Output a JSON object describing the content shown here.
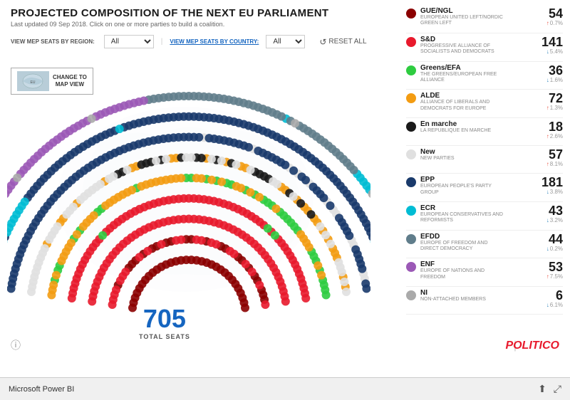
{
  "header": {
    "title": "PROJECTED COMPOSITION OF THE NEXT EU PARLIAMENT",
    "subtitle": "Last updated 09 Sep 2018. Click on one or more parties to build a coalition.",
    "view_region_label": "VIEW MEP SEATS BY REGION:",
    "view_country_label": "VIEW MEP SEATS BY COUNTRY:",
    "region_default": "All",
    "country_default": "All",
    "reset_label": "RESET ALL"
  },
  "map_button": {
    "text": "CHANGE TO\nMAP VIEW"
  },
  "chart": {
    "total_seats": "705",
    "total_seats_label": "TOTAL SEATS"
  },
  "parties": [
    {
      "id": "GUE_NGL",
      "name": "GUE/NGL",
      "desc": "EUROPEAN UNITED LEFT/NORDIC GREEN LEFT",
      "color": "#8B0000",
      "seats": "54",
      "change": "0.7%",
      "direction": "up"
    },
    {
      "id": "SD",
      "name": "S&D",
      "desc": "PROGRESSIVE ALLIANCE OF SOCIALISTS AND DEMOCRATS",
      "color": "#e8192c",
      "seats": "141",
      "change": "5.4%",
      "direction": "down"
    },
    {
      "id": "GREENS",
      "name": "Greens/EFA",
      "desc": "THE GREENS/EUROPEAN FREE ALLIANCE",
      "color": "#2ecc40",
      "seats": "36",
      "change": "1.6%",
      "direction": "down"
    },
    {
      "id": "ALDE",
      "name": "ALDE",
      "desc": "ALLIANCE OF LIBERALS AND DEMOCRATS FOR EUROPE",
      "color": "#f39c12",
      "seats": "72",
      "change": "1.3%",
      "direction": "up"
    },
    {
      "id": "EN_MARCHE",
      "name": "En marche",
      "desc": "LA REPUBLIQUE EN MARCHE",
      "color": "#1a1a1a",
      "seats": "18",
      "change": "2.6%",
      "direction": "up"
    },
    {
      "id": "NEW",
      "name": "New",
      "desc": "NEW PARTIES",
      "color": "#e0e0e0",
      "seats": "57",
      "change": "8.1%",
      "direction": "up"
    },
    {
      "id": "EPP",
      "name": "EPP",
      "desc": "EUROPEAN PEOPLE'S PARTY GROUP",
      "color": "#1a3a6b",
      "seats": "181",
      "change": "3.8%",
      "direction": "down"
    },
    {
      "id": "ECR",
      "name": "ECR",
      "desc": "EUROPEAN CONSERVATIVES AND REFORMISTS",
      "color": "#00bcd4",
      "seats": "43",
      "change": "3.2%",
      "direction": "down"
    },
    {
      "id": "EFDD",
      "name": "EFDD",
      "desc": "EUROPE OF FREEDOM AND DIRECT DEMOCRACY",
      "color": "#607d8b",
      "seats": "44",
      "change": "0.2%",
      "direction": "down"
    },
    {
      "id": "ENF",
      "name": "ENF",
      "desc": "EUROPE OF NATIONS AND FREEDOM",
      "color": "#9b59b6",
      "seats": "53",
      "change": "7.5%",
      "direction": "up"
    },
    {
      "id": "NI",
      "name": "NI",
      "desc": "NON-ATTACHED MEMBERS",
      "color": "#aaa",
      "seats": "6",
      "change": "6.1%",
      "direction": "down"
    }
  ],
  "bottom": {
    "app_name": "Microsoft Power BI",
    "brand": "POLITICO"
  }
}
